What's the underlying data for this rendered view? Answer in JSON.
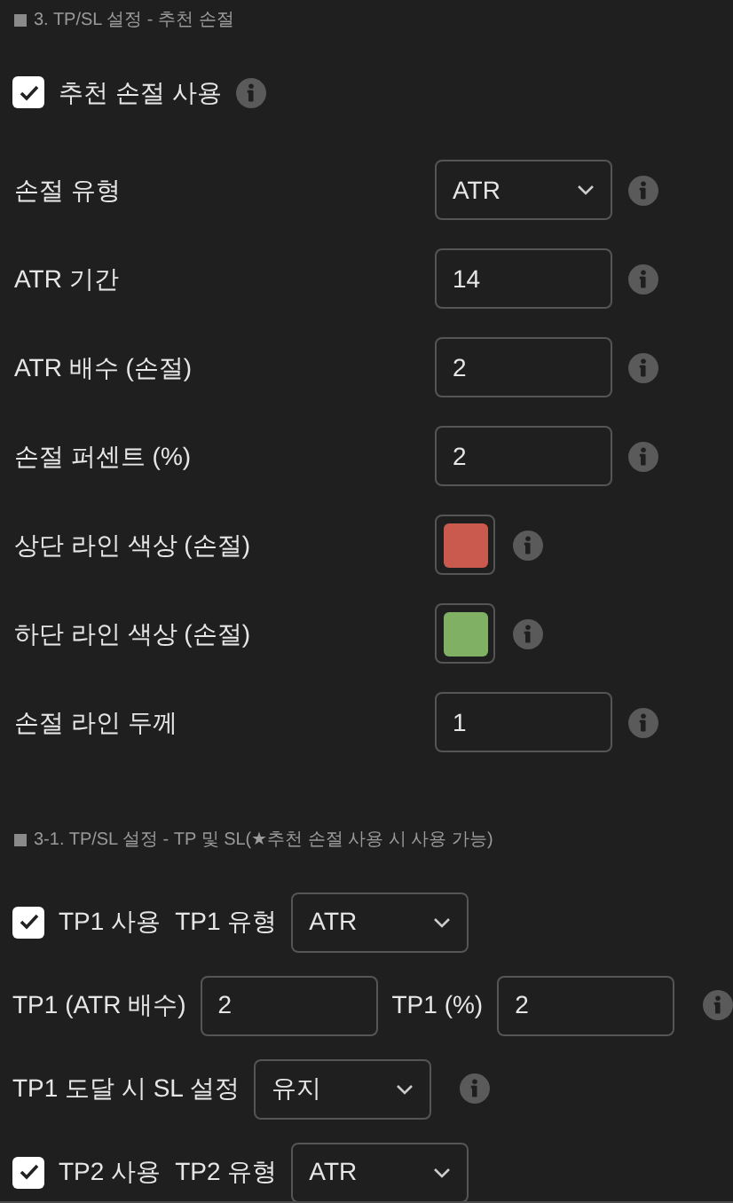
{
  "section_1": {
    "title": "3. TP/SL 설정 - 추천 손절",
    "rows": [
      {
        "kind": "checkbox",
        "label": "추천 손절 사용",
        "checked": true
      },
      {
        "kind": "select",
        "label": "손절 유형",
        "value": "ATR"
      },
      {
        "kind": "input",
        "label": "ATR 기간",
        "value": "14"
      },
      {
        "kind": "input",
        "label": "ATR 배수 (손절)",
        "value": "2"
      },
      {
        "kind": "input",
        "label": "손절 퍼센트 (%)",
        "value": "2"
      },
      {
        "kind": "color",
        "label": "상단 라인 색상 (손절)",
        "color": "#cb5a4e"
      },
      {
        "kind": "color",
        "label": "하단 라인 색상 (손절)",
        "color": "#7fb064"
      },
      {
        "kind": "input",
        "label": "손절 라인 두께",
        "value": "1"
      }
    ]
  },
  "section_2": {
    "title": "3-1. TP/SL 설정 -  TP 및 SL(★추천 손절 사용 시 사용 가능)",
    "rows": [
      {
        "items": [
          {
            "kind": "checkbox",
            "label": "TP1 사용",
            "checked": true
          },
          {
            "kind": "label",
            "text": "TP1 유형"
          },
          {
            "kind": "select",
            "value": "ATR"
          }
        ]
      },
      {
        "items": [
          {
            "kind": "label",
            "text": "TP1 (ATR 배수)"
          },
          {
            "kind": "input",
            "value": "2"
          },
          {
            "kind": "label",
            "text": "TP1 (%)"
          },
          {
            "kind": "input",
            "value": "2"
          },
          {
            "kind": "info"
          }
        ]
      },
      {
        "items": [
          {
            "kind": "label",
            "text": "TP1 도달 시 SL 설정"
          },
          {
            "kind": "select",
            "value": "유지"
          },
          {
            "kind": "info"
          }
        ]
      },
      {
        "items": [
          {
            "kind": "checkbox",
            "label": "TP2 사용",
            "checked": true
          },
          {
            "kind": "label",
            "text": "TP2 유형"
          },
          {
            "kind": "select",
            "value": "ATR"
          }
        ]
      }
    ]
  }
}
